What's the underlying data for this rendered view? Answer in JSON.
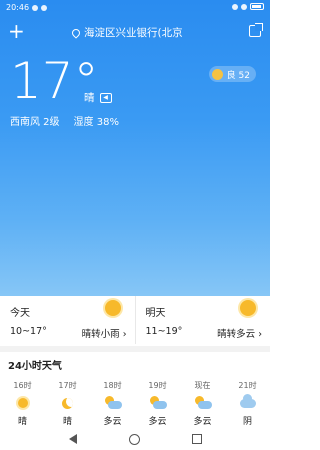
{
  "status": {
    "time": "20:46"
  },
  "header": {
    "location": "海淀区兴业银行(北京"
  },
  "current": {
    "temperature": "17°",
    "condition": "晴",
    "wind": "西南风 2级",
    "humidity": "湿度 38%"
  },
  "aqi": {
    "label": "良 52"
  },
  "forecast": [
    {
      "day": "今天",
      "range": "10~17°",
      "desc": "晴转小雨 ›"
    },
    {
      "day": "明天",
      "range": "11~19°",
      "desc": "晴转多云 ›"
    }
  ],
  "hourly_title": "24小时天气",
  "hourly": [
    {
      "time": "16时",
      "icon": "sun-icon",
      "weather": "晴"
    },
    {
      "time": "17时",
      "icon": "moon-icon",
      "weather": "晴"
    },
    {
      "time": "18时",
      "icon": "partly-cloudy-icon",
      "weather": "多云"
    },
    {
      "time": "19时",
      "icon": "partly-cloudy-icon",
      "weather": "多云"
    },
    {
      "time": "现在",
      "icon": "partly-cloudy-icon",
      "weather": "多云"
    },
    {
      "time": "21时",
      "icon": "cloud-icon",
      "weather": "阴"
    }
  ]
}
